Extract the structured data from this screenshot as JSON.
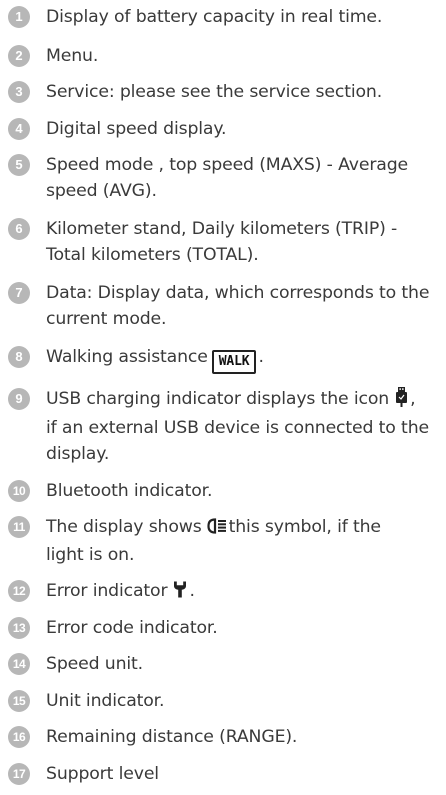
{
  "items": [
    {
      "n": "1",
      "text": "Display of battery capacity in real time."
    },
    {
      "n": "2",
      "text": "Menu."
    },
    {
      "n": "3",
      "text": "Service: please see the service section."
    },
    {
      "n": "4",
      "text": "Digital speed display."
    },
    {
      "n": "5",
      "lines": [
        "Speed mode , top speed (MAXS) - Average",
        "speed (AVG)."
      ]
    },
    {
      "n": "6",
      "lines": [
        "Kilometer stand, Daily kilometers (TRIP) -",
        "Total kilometers (TOTAL)."
      ]
    },
    {
      "n": "7",
      "lines": [
        "Data: Display data, which corresponds to the",
        "current mode."
      ]
    },
    {
      "n": "8",
      "before": "Walking assistance",
      "badge": "WALK",
      "after": "."
    },
    {
      "n": "9",
      "before": "USB charging indicator displays the icon",
      "after": ",",
      "lines": [
        "if an external USB device is connected to the",
        "display."
      ]
    },
    {
      "n": "10",
      "text": "Bluetooth indicator."
    },
    {
      "n": "11",
      "before": "The display shows",
      "after": "this symbol, if the",
      "line2": "light is on."
    },
    {
      "n": "12",
      "before": "Error indicator",
      "after": "."
    },
    {
      "n": "13",
      "text": "Error code indicator."
    },
    {
      "n": "14",
      "text": "Speed unit."
    },
    {
      "n": "15",
      "text": "Unit indicator."
    },
    {
      "n": "16",
      "text": "Remaining distance (RANGE)."
    },
    {
      "n": "17",
      "text": "Support level"
    }
  ],
  "icons": [
    "walk-badge-icon",
    "usb-plug-icon",
    "headlight-icon",
    "wrench-icon"
  ]
}
